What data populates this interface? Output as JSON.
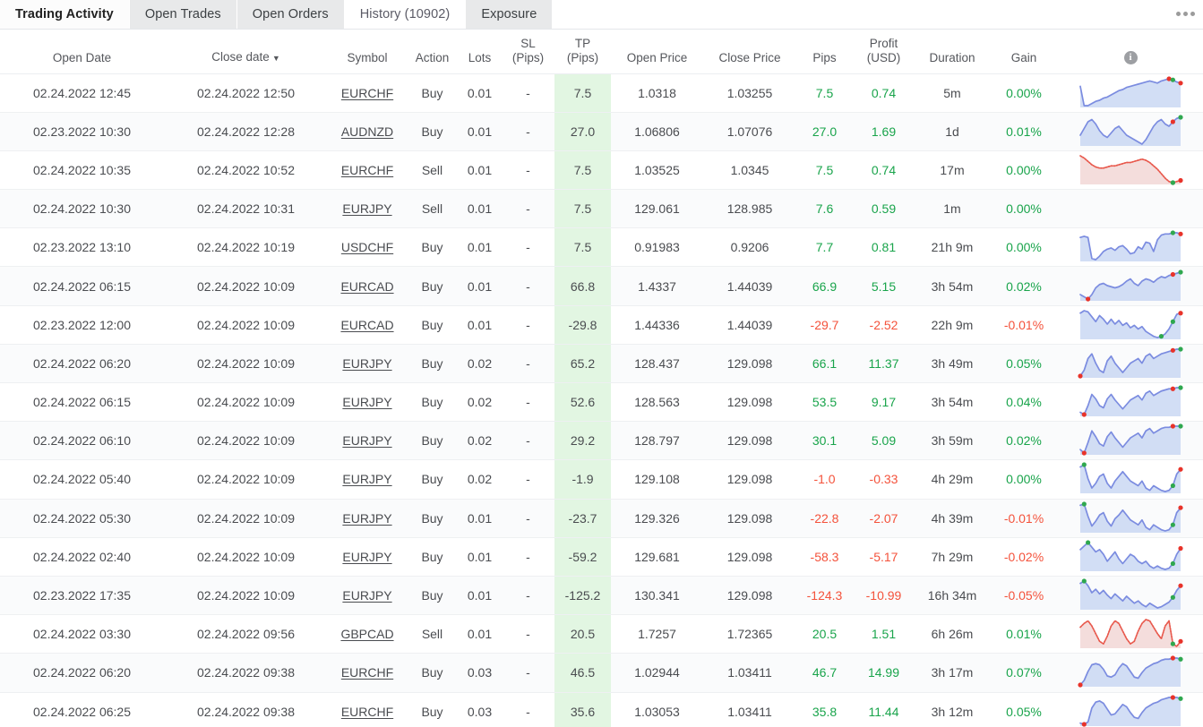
{
  "tabs": [
    {
      "label": "Trading Activity",
      "active": false,
      "first": true
    },
    {
      "label": "Open Trades",
      "active": false,
      "first": false
    },
    {
      "label": "Open Orders",
      "active": false,
      "first": false
    },
    {
      "label": "History (10902)",
      "active": true,
      "first": false
    },
    {
      "label": "Exposure",
      "active": false,
      "first": false
    }
  ],
  "overflow_menu": "more-options",
  "columns": {
    "open_date": "Open Date",
    "close_date": "Close date",
    "close_date_sort": "▼",
    "symbol": "Symbol",
    "action": "Action",
    "lots": "Lots",
    "sl_l1": "SL",
    "sl_l2": "(Pips)",
    "tp_l1": "TP",
    "tp_l2": "(Pips)",
    "open_price": "Open Price",
    "close_price": "Close Price",
    "pips": "Pips",
    "profit_l1": "Profit",
    "profit_l2": "(USD)",
    "duration": "Duration",
    "gain": "Gain",
    "chart_info": "i"
  },
  "colors": {
    "positive": "#19a44b",
    "negative": "#f4523b",
    "neutral": "#4a4c50",
    "tp_highlight": "#e2f6e2",
    "buy_line": "#7b8ce0",
    "buy_fill": "#c3d3f2",
    "sell_line": "#e8584c",
    "sell_fill": "#f0d2d0",
    "marker_start": "#2fa84f",
    "marker_end": "#e8332a"
  },
  "rows": [
    {
      "open_date": "02.24.2022 12:45",
      "close_date": "02.24.2022 12:50",
      "symbol": "EURCHF",
      "action": "Buy",
      "lots": "0.01",
      "sl": "-",
      "tp": "7.5",
      "open_price": "1.0318",
      "close_price": "1.03255",
      "pips": "7.5",
      "pips_sign": "pos",
      "profit": "0.74",
      "profit_sign": "pos",
      "duration": "5m",
      "gain": "0.00%",
      "gain_sign": "pos",
      "spark": {
        "dir": "up",
        "points": [
          8,
          26,
          26,
          24,
          22,
          21,
          19,
          18,
          16,
          14,
          12,
          11,
          9,
          8,
          7,
          6,
          5,
          4,
          3,
          4,
          5,
          3,
          2,
          1,
          2,
          4,
          5
        ],
        "m_start": "red",
        "m_end": "red",
        "peak_idx": 23
      }
    },
    {
      "open_date": "02.23.2022 10:30",
      "close_date": "02.24.2022 12:28",
      "symbol": "AUDNZD",
      "action": "Buy",
      "lots": "0.01",
      "sl": "-",
      "tp": "27.0",
      "open_price": "1.06806",
      "close_price": "1.07076",
      "pips": "27.0",
      "pips_sign": "pos",
      "profit": "1.69",
      "profit_sign": "pos",
      "duration": "1d",
      "gain": "0.01%",
      "gain_sign": "pos",
      "spark": {
        "dir": "up",
        "points": [
          18,
          12,
          6,
          4,
          8,
          14,
          18,
          20,
          16,
          12,
          10,
          14,
          18,
          20,
          22,
          24,
          26,
          22,
          16,
          10,
          6,
          4,
          8,
          10,
          6,
          3,
          2
        ],
        "m_start": "none",
        "m_end": "green",
        "low_idx": 21
      }
    },
    {
      "open_date": "02.24.2022 10:35",
      "close_date": "02.24.2022 10:52",
      "symbol": "EURCHF",
      "action": "Sell",
      "lots": "0.01",
      "sl": "-",
      "tp": "7.5",
      "open_price": "1.03525",
      "close_price": "1.0345",
      "pips": "7.5",
      "pips_sign": "pos",
      "profit": "0.74",
      "profit_sign": "pos",
      "duration": "17m",
      "gain": "0.00%",
      "gain_sign": "pos",
      "spark": {
        "dir": "down",
        "points": [
          2,
          4,
          7,
          10,
          12,
          13,
          13,
          12,
          11,
          11,
          10,
          9,
          8,
          8,
          7,
          6,
          5,
          6,
          8,
          11,
          14,
          18,
          22,
          25,
          26,
          25,
          24
        ],
        "m_start": "green",
        "m_end": "red",
        "low_idx": 24
      }
    },
    {
      "open_date": "02.24.2022 10:30",
      "close_date": "02.24.2022 10:31",
      "symbol": "EURJPY",
      "action": "Sell",
      "lots": "0.01",
      "sl": "-",
      "tp": "7.5",
      "open_price": "129.061",
      "close_price": "128.985",
      "pips": "7.6",
      "pips_sign": "pos",
      "profit": "0.59",
      "profit_sign": "pos",
      "duration": "1m",
      "gain": "0.00%",
      "gain_sign": "pos",
      "spark": null
    },
    {
      "open_date": "02.23.2022 13:10",
      "close_date": "02.24.2022 10:19",
      "symbol": "USDCHF",
      "action": "Buy",
      "lots": "0.01",
      "sl": "-",
      "tp": "7.5",
      "open_price": "0.91983",
      "close_price": "0.9206",
      "pips": "7.7",
      "pips_sign": "pos",
      "profit": "0.81",
      "profit_sign": "pos",
      "duration": "21h 9m",
      "gain": "0.00%",
      "gain_sign": "pos",
      "spark": {
        "dir": "up",
        "points": [
          6,
          5,
          6,
          24,
          25,
          22,
          18,
          16,
          15,
          17,
          14,
          13,
          16,
          20,
          19,
          14,
          16,
          10,
          11,
          18,
          8,
          4,
          3,
          3,
          2,
          2,
          3
        ],
        "m_start": "none",
        "m_end": "red",
        "low_idx": 3
      }
    },
    {
      "open_date": "02.24.2022 06:15",
      "close_date": "02.24.2022 10:09",
      "symbol": "EURCAD",
      "action": "Buy",
      "lots": "0.01",
      "sl": "-",
      "tp": "66.8",
      "open_price": "1.4337",
      "close_price": "1.44039",
      "pips": "66.9",
      "pips_sign": "pos",
      "profit": "5.15",
      "profit_sign": "pos",
      "duration": "3h 54m",
      "gain": "0.02%",
      "gain_sign": "pos",
      "spark": {
        "dir": "up",
        "points": [
          22,
          24,
          26,
          22,
          16,
          13,
          12,
          14,
          15,
          16,
          15,
          13,
          10,
          8,
          12,
          14,
          10,
          8,
          9,
          11,
          8,
          6,
          7,
          5,
          4,
          3,
          2
        ],
        "m_start": "red",
        "m_end": "green",
        "low_idx": 2
      }
    },
    {
      "open_date": "02.23.2022 12:00",
      "close_date": "02.24.2022 10:09",
      "symbol": "EURCAD",
      "action": "Buy",
      "lots": "0.01",
      "sl": "-",
      "tp": "-29.8",
      "open_price": "1.44336",
      "close_price": "1.44039",
      "pips": "-29.7",
      "pips_sign": "neg",
      "profit": "-2.52",
      "profit_sign": "neg",
      "duration": "22h 9m",
      "gain": "-0.01%",
      "gain_sign": "neg",
      "spark": {
        "dir": "up",
        "points": [
          5,
          3,
          4,
          8,
          12,
          7,
          10,
          14,
          10,
          14,
          11,
          15,
          13,
          17,
          15,
          18,
          16,
          20,
          22,
          24,
          25,
          24,
          22,
          18,
          12,
          6,
          5
        ],
        "m_start": "green",
        "m_end": "red",
        "low_idx": 21
      }
    },
    {
      "open_date": "02.24.2022 06:20",
      "close_date": "02.24.2022 10:09",
      "symbol": "EURJPY",
      "action": "Buy",
      "lots": "0.02",
      "sl": "-",
      "tp": "65.2",
      "open_price": "128.437",
      "close_price": "129.098",
      "pips": "66.1",
      "pips_sign": "pos",
      "profit": "11.37",
      "profit_sign": "pos",
      "duration": "3h 49m",
      "gain": "0.05%",
      "gain_sign": "pos",
      "spark": {
        "dir": "up",
        "points": [
          25,
          20,
          10,
          6,
          14,
          20,
          22,
          12,
          8,
          14,
          18,
          22,
          18,
          14,
          12,
          10,
          14,
          8,
          6,
          10,
          8,
          6,
          5,
          4,
          3,
          2,
          2
        ],
        "m_start": "red",
        "m_end": "green",
        "low_idx": 0
      }
    },
    {
      "open_date": "02.24.2022 06:15",
      "close_date": "02.24.2022 10:09",
      "symbol": "EURJPY",
      "action": "Buy",
      "lots": "0.02",
      "sl": "-",
      "tp": "52.6",
      "open_price": "128.563",
      "close_price": "129.098",
      "pips": "53.5",
      "pips_sign": "pos",
      "profit": "9.17",
      "profit_sign": "pos",
      "duration": "3h 54m",
      "gain": "0.04%",
      "gain_sign": "pos",
      "spark": {
        "dir": "up",
        "points": [
          24,
          26,
          18,
          8,
          12,
          18,
          20,
          12,
          8,
          13,
          17,
          21,
          17,
          13,
          11,
          9,
          13,
          7,
          5,
          9,
          7,
          5,
          4,
          3,
          3,
          2,
          2
        ],
        "m_start": "red",
        "m_end": "green",
        "low_idx": 1
      }
    },
    {
      "open_date": "02.24.2022 06:10",
      "close_date": "02.24.2022 10:09",
      "symbol": "EURJPY",
      "action": "Buy",
      "lots": "0.02",
      "sl": "-",
      "tp": "29.2",
      "open_price": "128.797",
      "close_price": "129.098",
      "pips": "30.1",
      "pips_sign": "pos",
      "profit": "5.09",
      "profit_sign": "pos",
      "duration": "3h 59m",
      "gain": "0.02%",
      "gain_sign": "pos",
      "spark": {
        "dir": "up",
        "points": [
          22,
          25,
          16,
          6,
          11,
          17,
          19,
          11,
          7,
          12,
          16,
          20,
          16,
          12,
          10,
          8,
          12,
          6,
          4,
          8,
          6,
          4,
          3,
          3,
          2,
          2,
          2
        ],
        "m_start": "red",
        "m_end": "green",
        "low_idx": 1
      }
    },
    {
      "open_date": "02.24.2022 05:40",
      "close_date": "02.24.2022 10:09",
      "symbol": "EURJPY",
      "action": "Buy",
      "lots": "0.02",
      "sl": "-",
      "tp": "-1.9",
      "open_price": "129.108",
      "close_price": "129.098",
      "pips": "-1.0",
      "pips_sign": "neg",
      "profit": "-0.33",
      "profit_sign": "neg",
      "duration": "4h 29m",
      "gain": "0.00%",
      "gain_sign": "pos",
      "spark": {
        "dir": "up",
        "points": [
          4,
          2,
          14,
          22,
          18,
          12,
          10,
          18,
          22,
          16,
          12,
          8,
          12,
          16,
          18,
          20,
          16,
          22,
          24,
          20,
          22,
          24,
          25,
          24,
          20,
          10,
          6
        ],
        "m_start": "green",
        "m_end": "red",
        "low_idx": 1
      }
    },
    {
      "open_date": "02.24.2022 05:30",
      "close_date": "02.24.2022 10:09",
      "symbol": "EURJPY",
      "action": "Buy",
      "lots": "0.01",
      "sl": "-",
      "tp": "-23.7",
      "open_price": "129.326",
      "close_price": "129.098",
      "pips": "-22.8",
      "pips_sign": "neg",
      "profit": "-2.07",
      "profit_sign": "neg",
      "duration": "4h 39m",
      "gain": "-0.01%",
      "gain_sign": "neg",
      "spark": {
        "dir": "up",
        "points": [
          3,
          2,
          12,
          20,
          16,
          11,
          9,
          16,
          20,
          14,
          11,
          7,
          11,
          15,
          17,
          19,
          15,
          21,
          23,
          19,
          21,
          23,
          24,
          23,
          19,
          9,
          5
        ],
        "m_start": "green",
        "m_end": "red",
        "low_idx": 1
      }
    },
    {
      "open_date": "02.24.2022 02:40",
      "close_date": "02.24.2022 10:09",
      "symbol": "EURJPY",
      "action": "Buy",
      "lots": "0.01",
      "sl": "-",
      "tp": "-59.2",
      "open_price": "129.681",
      "close_price": "129.098",
      "pips": "-58.3",
      "pips_sign": "neg",
      "profit": "-5.17",
      "profit_sign": "neg",
      "duration": "7h 29m",
      "gain": "-0.02%",
      "gain_sign": "neg",
      "spark": {
        "dir": "up",
        "points": [
          8,
          5,
          2,
          6,
          10,
          8,
          12,
          18,
          14,
          10,
          16,
          20,
          16,
          12,
          14,
          18,
          20,
          18,
          22,
          24,
          22,
          24,
          25,
          24,
          20,
          12,
          7
        ],
        "m_start": "green",
        "m_end": "red",
        "low_idx": 2
      }
    },
    {
      "open_date": "02.23.2022 17:35",
      "close_date": "02.24.2022 10:09",
      "symbol": "EURJPY",
      "action": "Buy",
      "lots": "0.01",
      "sl": "-",
      "tp": "-125.2",
      "open_price": "130.341",
      "close_price": "129.098",
      "pips": "-124.3",
      "pips_sign": "neg",
      "profit": "-10.99",
      "profit_sign": "neg",
      "duration": "16h 34m",
      "gain": "-0.05%",
      "gain_sign": "neg",
      "spark": {
        "dir": "up",
        "points": [
          4,
          2,
          6,
          12,
          9,
          13,
          10,
          14,
          17,
          13,
          16,
          19,
          15,
          18,
          21,
          19,
          22,
          24,
          21,
          23,
          25,
          24,
          22,
          20,
          16,
          10,
          6
        ],
        "m_start": "green",
        "m_end": "red",
        "low_idx": 1
      }
    },
    {
      "open_date": "02.24.2022 03:30",
      "close_date": "02.24.2022 09:56",
      "symbol": "GBPCAD",
      "action": "Sell",
      "lots": "0.01",
      "sl": "-",
      "tp": "20.5",
      "open_price": "1.7257",
      "close_price": "1.72365",
      "pips": "20.5",
      "pips_sign": "pos",
      "profit": "1.51",
      "profit_sign": "pos",
      "duration": "6h 26m",
      "gain": "0.01%",
      "gain_sign": "pos",
      "spark": {
        "dir": "down",
        "points": [
          9,
          6,
          4,
          8,
          14,
          20,
          22,
          16,
          8,
          4,
          6,
          12,
          18,
          22,
          20,
          12,
          6,
          3,
          4,
          9,
          14,
          18,
          8,
          4,
          22,
          24,
          20
        ],
        "m_start": "none",
        "m_end": "red",
        "peak_idx": 17
      }
    },
    {
      "open_date": "02.24.2022 06:20",
      "close_date": "02.24.2022 09:38",
      "symbol": "EURCHF",
      "action": "Buy",
      "lots": "0.03",
      "sl": "-",
      "tp": "46.5",
      "open_price": "1.02944",
      "close_price": "1.03411",
      "pips": "46.7",
      "pips_sign": "pos",
      "profit": "14.99",
      "profit_sign": "pos",
      "duration": "3h 17m",
      "gain": "0.07%",
      "gain_sign": "pos",
      "spark": {
        "dir": "up",
        "points": [
          26,
          22,
          14,
          8,
          7,
          8,
          12,
          18,
          19,
          17,
          11,
          7,
          9,
          14,
          19,
          20,
          15,
          11,
          9,
          7,
          6,
          4,
          3,
          3,
          2,
          2,
          3
        ],
        "m_start": "red",
        "m_end": "green",
        "low_idx": 0
      }
    },
    {
      "open_date": "02.24.2022 06:25",
      "close_date": "02.24.2022 09:38",
      "symbol": "EURCHF",
      "action": "Buy",
      "lots": "0.03",
      "sl": "-",
      "tp": "35.6",
      "open_price": "1.03053",
      "close_price": "1.03411",
      "pips": "35.8",
      "pips_sign": "pos",
      "profit": "11.44",
      "profit_sign": "pos",
      "duration": "3h 12m",
      "gain": "0.05%",
      "gain_sign": "pos",
      "spark": {
        "dir": "up",
        "points": [
          25,
          26,
          24,
          12,
          7,
          6,
          8,
          13,
          18,
          17,
          13,
          9,
          11,
          16,
          20,
          21,
          16,
          12,
          10,
          8,
          7,
          5,
          4,
          3,
          3,
          3,
          4
        ],
        "m_start": "red",
        "m_end": "green",
        "low_idx": 1
      }
    }
  ]
}
